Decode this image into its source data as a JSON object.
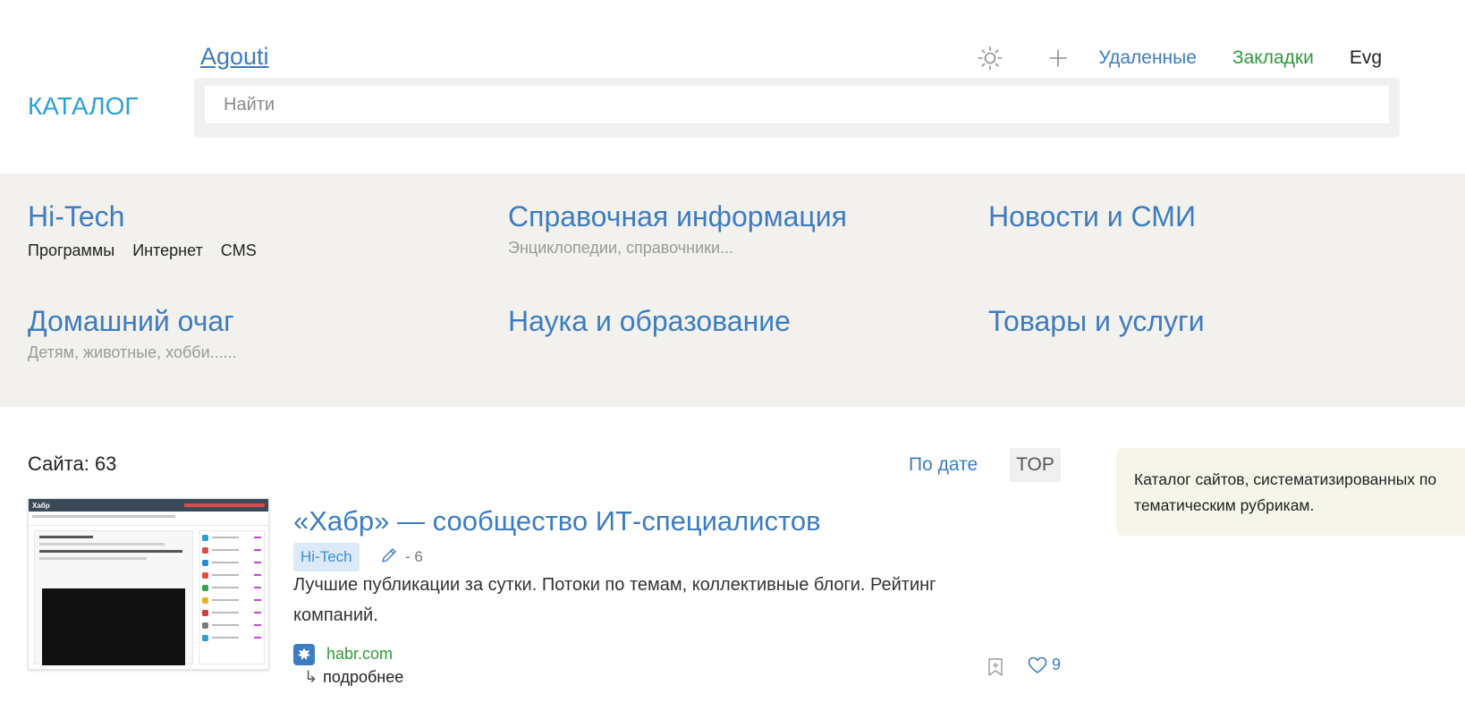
{
  "header": {
    "brand": "Agouti",
    "catalog": "КАТАЛОГ",
    "nav": {
      "theme_icon": "sun-icon",
      "add_icon": "plus-icon",
      "deleted": "Удаленные",
      "bookmarks": "Закладки",
      "user": "Evg"
    },
    "search": {
      "placeholder": "Найти",
      "value": ""
    }
  },
  "colors": {
    "link": "#3d7cc0",
    "catalog": "#2aa0db",
    "green": "#2e9b3a",
    "band": "#f3f1ed",
    "info_bg": "#f6f5ea"
  },
  "categories": [
    {
      "title": "Hi-Tech",
      "links": [
        "Программы",
        "Интернет",
        "CMS"
      ]
    },
    {
      "title": "Справочная информация",
      "subtitle": "Энциклопедии, справочники..."
    },
    {
      "title": "Новости и СМИ"
    },
    {
      "title": "Домашний очаг",
      "subtitle": "Детям, животные, хобби......"
    },
    {
      "title": "Наука и образование"
    },
    {
      "title": "Товары и услуги"
    }
  ],
  "listing": {
    "count": "Сайта: 63",
    "sort_date": "По дате",
    "sort_top": "TOP",
    "info": "Каталог сайтов, систематизированных по тематическим рубрикам."
  },
  "site": {
    "thumb_brand": "Хабр",
    "title": "«Хабр» — сообщество ИТ-специалистов",
    "tag": "Hi-Tech",
    "edits": "- 6",
    "description": "Лучшие публикации за сутки. Потоки по темам, коллективные блоги. Рейтинг компаний.",
    "domain": "habr.com",
    "more": "подробнее",
    "likes": "9"
  }
}
